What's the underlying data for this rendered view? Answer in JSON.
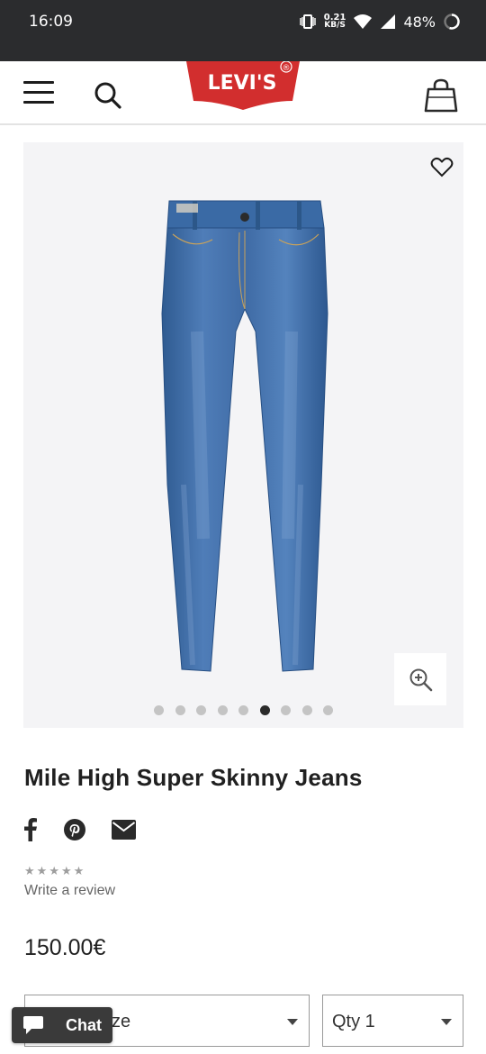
{
  "status_bar": {
    "time": "16:09",
    "net_speed_value": "0.21",
    "net_speed_unit": "KB/S",
    "battery": "48%"
  },
  "header": {
    "logo_text": "LEVI'S",
    "logo_mark": "®",
    "brand_color": "#d22e2e"
  },
  "gallery": {
    "image_count": 9,
    "active_index": 5
  },
  "product": {
    "title": "Mile High Super Skinny Jeans",
    "rating_stars": 5,
    "rating_value": 0,
    "write_review": "Write a review",
    "price": "150.00€"
  },
  "size_select": {
    "label": "ze"
  },
  "qty_select": {
    "label": "Qty 1"
  },
  "chat": {
    "label": "Chat"
  },
  "icons": [
    "menu-icon",
    "search-icon",
    "bag-icon",
    "heart-icon",
    "zoom-in-icon",
    "facebook-icon",
    "pinterest-icon",
    "email-icon",
    "chat-icon",
    "star-icon"
  ]
}
